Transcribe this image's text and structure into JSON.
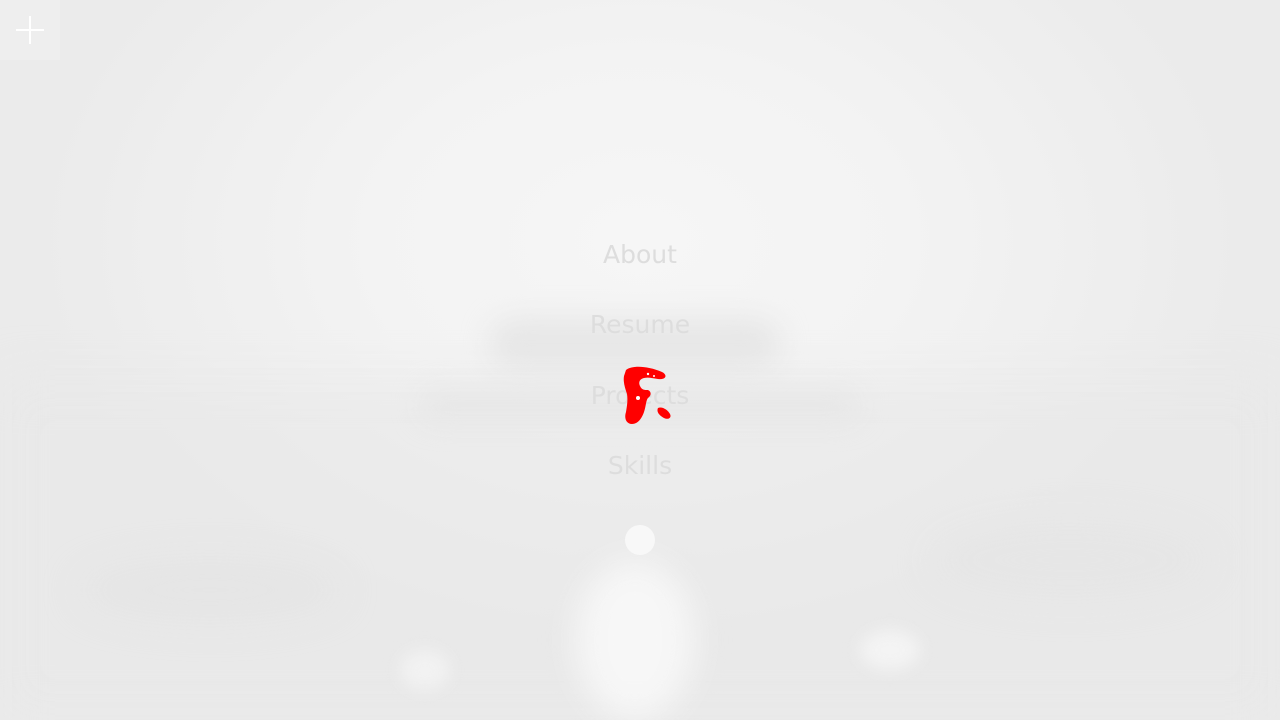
{
  "menu": {
    "toggle_icon": "plus-icon"
  },
  "nav": {
    "items": [
      {
        "label": "About"
      },
      {
        "label": "Resume"
      },
      {
        "label": "Projects"
      },
      {
        "label": "Skills"
      }
    ]
  },
  "indicator": {
    "icon": "circle-dot"
  },
  "colors": {
    "nav_text": "#dddddd",
    "background": "#f0f0f0",
    "cursor_mark": "#ff0000"
  }
}
